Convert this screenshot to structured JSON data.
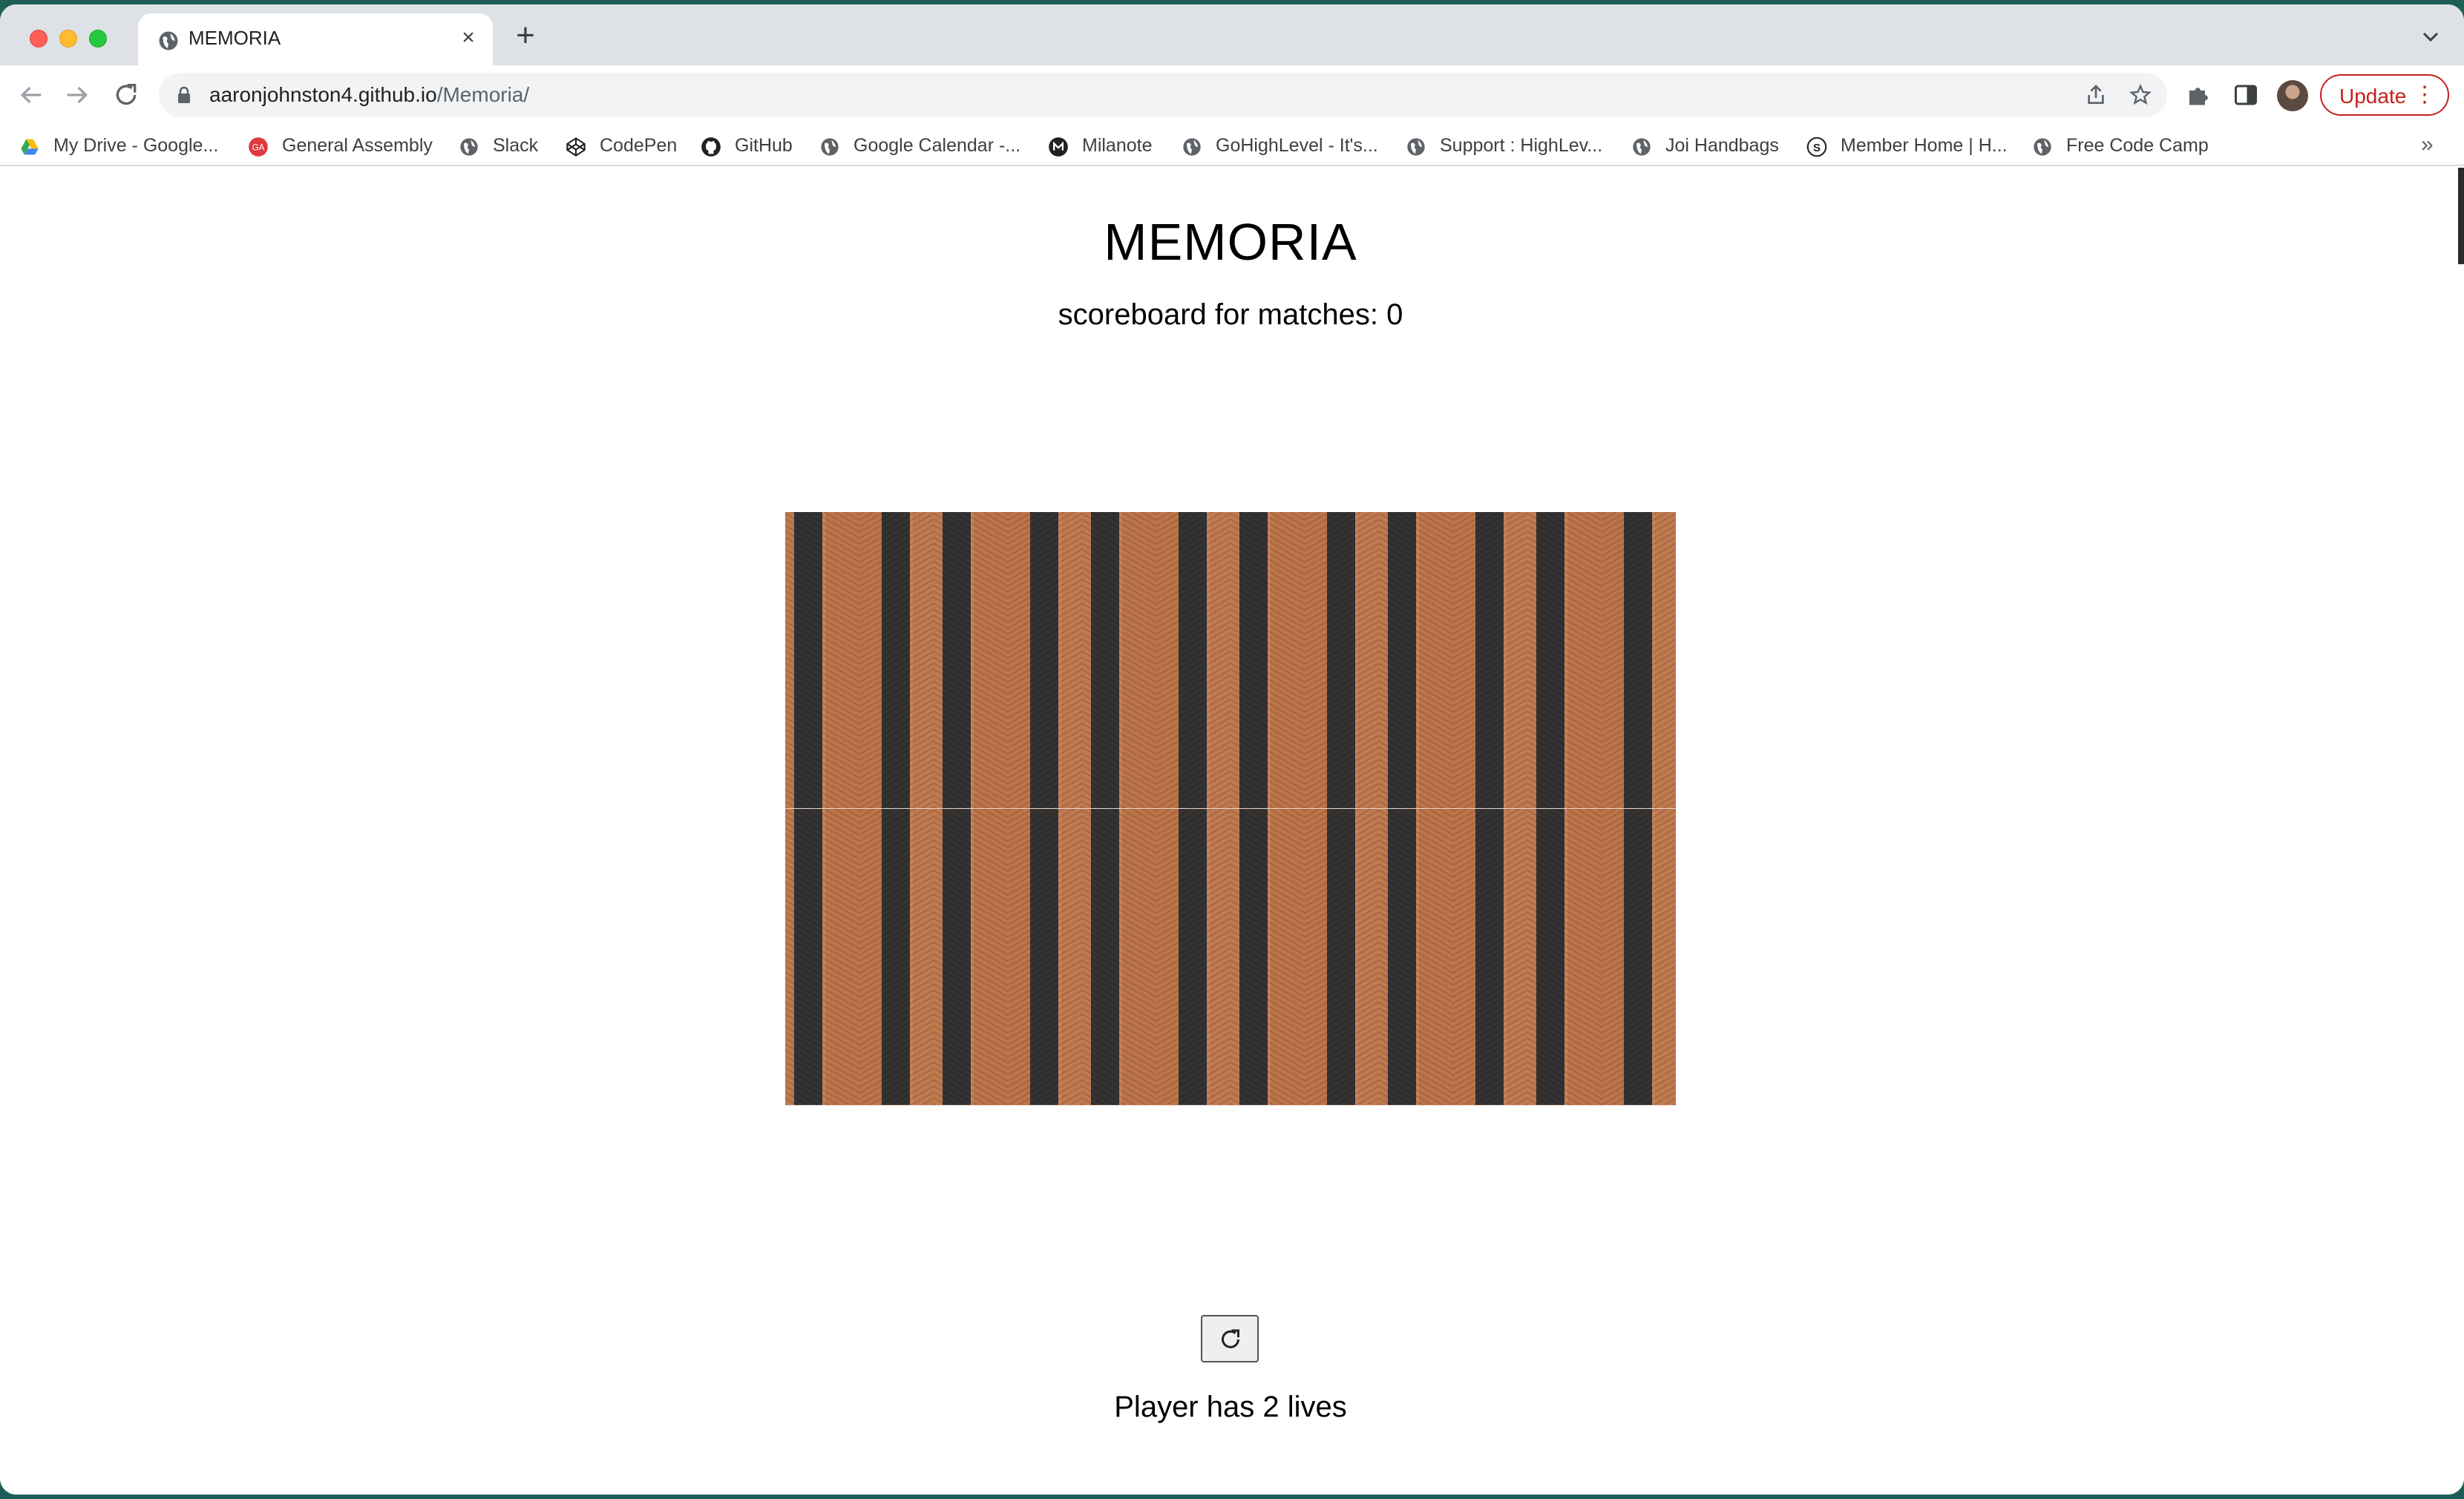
{
  "browser": {
    "tab_title": "MEMORIA",
    "url_host": "aaronjohnston4.github.io",
    "url_path": "/Memoria/",
    "update_label": "Update",
    "bookmarks": [
      {
        "label": "My Drive - Google...",
        "icon": "google-drive-icon"
      },
      {
        "label": "General Assembly",
        "icon": "general-assembly-icon"
      },
      {
        "label": "Slack",
        "icon": "globe-icon"
      },
      {
        "label": "CodePen",
        "icon": "codepen-icon"
      },
      {
        "label": "GitHub",
        "icon": "github-icon"
      },
      {
        "label": "Google Calendar -...",
        "icon": "globe-icon"
      },
      {
        "label": "Milanote",
        "icon": "milanote-icon"
      },
      {
        "label": "GoHighLevel - It's...",
        "icon": "globe-icon"
      },
      {
        "label": "Support : HighLev...",
        "icon": "globe-icon"
      },
      {
        "label": "Joi Handbags",
        "icon": "globe-icon"
      },
      {
        "label": "Member Home | H...",
        "icon": "skool-icon"
      },
      {
        "label": "Free Code Camp",
        "icon": "globe-icon"
      }
    ],
    "bookmarks_more": "»"
  },
  "game": {
    "title": "MEMORIA",
    "scoreboard": "scoreboard for matches: 0",
    "lives": "Player has 2 lives",
    "reset_icon": "refresh-icon",
    "card_count": 24,
    "card_back": "striped-fabric-pattern"
  },
  "colors": {
    "card_stripe_dark": "#3b4a5b",
    "card_stripe_light": "#dcb08f",
    "update_red": "#c5221f"
  }
}
